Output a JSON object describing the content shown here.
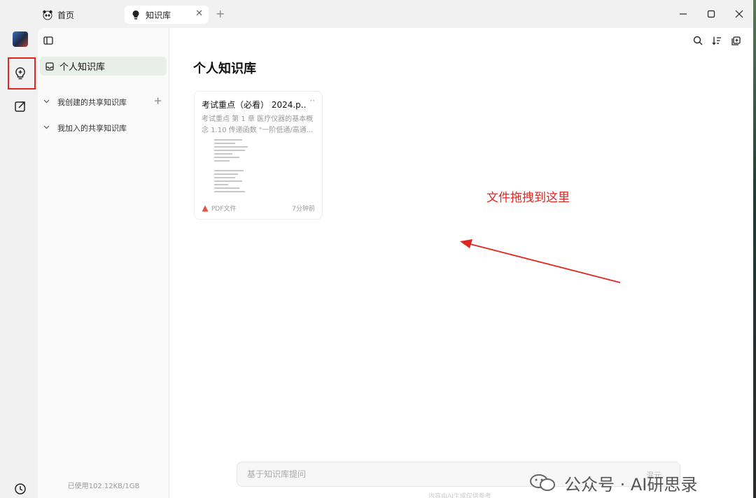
{
  "tabs": [
    {
      "label": "首页"
    },
    {
      "label": "知识库"
    }
  ],
  "sidebar": {
    "active_item": "个人知识库",
    "groups": [
      {
        "label": "我创建的共享知识库"
      },
      {
        "label": "我加入的共享知识库"
      }
    ],
    "storage": "已使用102.12KB/1GB"
  },
  "main": {
    "title": "个人知识库",
    "card": {
      "title": "考试重点（必看） 2024.p...",
      "summary": "考试重点 第 1 章 医疗仪器的基本概念 1.10 传递函数 \"一阶低通/高通...",
      "type": "PDF文件",
      "time": "7分钟前"
    },
    "annotation": "文件拖拽到这里",
    "ask_placeholder": "基于知识库提问",
    "ask_send": "混元",
    "bottom_hint": "内容由AI生成仅供参考"
  },
  "watermark": "公众号 · AI研思录",
  "colors": {
    "accent_red": "#e0261f",
    "active_bg": "#e8eeea"
  },
  "icons": [
    "panda-icon",
    "lightbulb-icon",
    "close-icon",
    "plus-icon",
    "minimize-icon",
    "maximize-icon",
    "avatar",
    "edit-icon",
    "clock-icon",
    "sidebar-toggle-icon",
    "search-icon",
    "sort-icon",
    "new-note-icon",
    "pdf-icon",
    "wechat-icon"
  ]
}
